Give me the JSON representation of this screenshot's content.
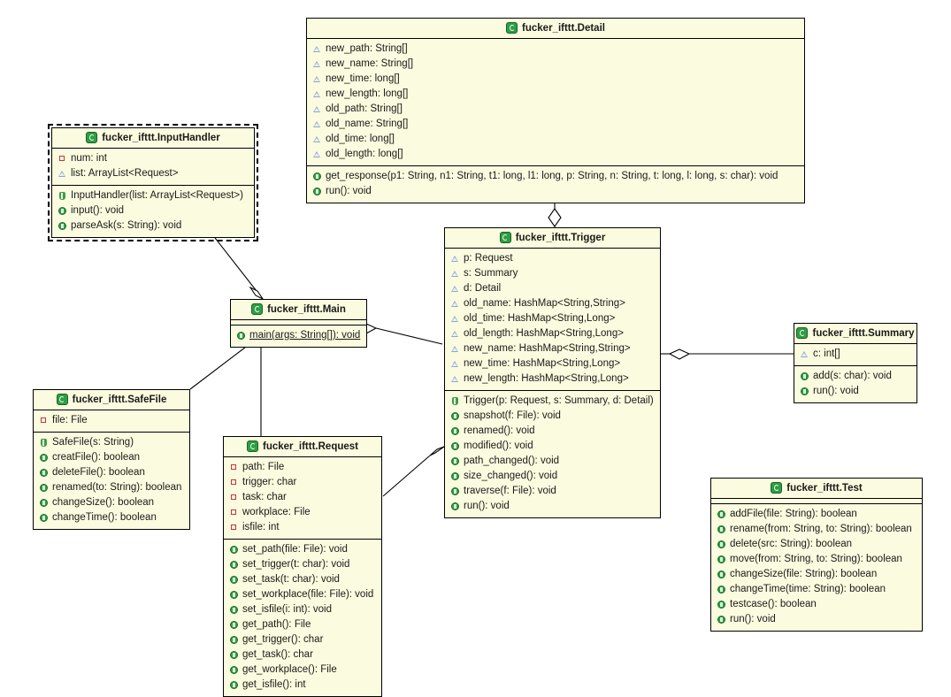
{
  "diagram": {
    "title": "fucker_ifttt UML class diagram",
    "colors": {
      "class_fill": "#fbfbdf",
      "class_border": "#000000",
      "icon_green": "#2f9e44",
      "private_red": "#c0392b",
      "package_blue": "#8fa8c8",
      "background": "#ffffff"
    }
  },
  "classes": {
    "detail": {
      "name": "fucker_ifttt.Detail",
      "attributes": [
        {
          "marker": "pkg",
          "text": "new_path: String[]"
        },
        {
          "marker": "pkg",
          "text": "new_name: String[]"
        },
        {
          "marker": "pkg",
          "text": "new_time: long[]"
        },
        {
          "marker": "pkg",
          "text": "new_length: long[]"
        },
        {
          "marker": "pkg",
          "text": "old_path: String[]"
        },
        {
          "marker": "pkg",
          "text": "old_name: String[]"
        },
        {
          "marker": "pkg",
          "text": "old_time: long[]"
        },
        {
          "marker": "pkg",
          "text": "old_length: long[]"
        }
      ],
      "methods": [
        {
          "marker": "pub",
          "text": "get_response(p1: String, n1: String, t1: long, l1: long, p: String, n: String, t: long, l: long, s: char): void"
        },
        {
          "marker": "pub",
          "text": "run(): void"
        }
      ]
    },
    "inputhandler": {
      "name": "fucker_ifttt.InputHandler",
      "selected": true,
      "attributes": [
        {
          "marker": "priv",
          "text": "num: int"
        },
        {
          "marker": "pkg",
          "text": "list: ArrayList<Request>"
        }
      ],
      "methods": [
        {
          "marker": "ctor",
          "text": "InputHandler(list: ArrayList<Request>)"
        },
        {
          "marker": "pub",
          "text": "input(): void"
        },
        {
          "marker": "pub",
          "text": "parseAsk(s: String): void"
        }
      ]
    },
    "main": {
      "name": "fucker_ifttt.Main",
      "attributes": [],
      "methods": [
        {
          "marker": "pub",
          "text": "main(args: String[]): void",
          "static": true
        }
      ]
    },
    "trigger": {
      "name": "fucker_ifttt.Trigger",
      "attributes": [
        {
          "marker": "pkg",
          "text": "p: Request"
        },
        {
          "marker": "pkg",
          "text": "s: Summary"
        },
        {
          "marker": "pkg",
          "text": "d: Detail"
        },
        {
          "marker": "pkg",
          "text": "old_name: HashMap<String,String>"
        },
        {
          "marker": "pkg",
          "text": "old_time: HashMap<String,Long>"
        },
        {
          "marker": "pkg",
          "text": "old_length: HashMap<String,Long>"
        },
        {
          "marker": "pkg",
          "text": "new_name: HashMap<String,String>"
        },
        {
          "marker": "pkg",
          "text": "new_time: HashMap<String,Long>"
        },
        {
          "marker": "pkg",
          "text": "new_length: HashMap<String,Long>"
        }
      ],
      "methods": [
        {
          "marker": "ctor",
          "text": "Trigger(p: Request, s: Summary, d: Detail)"
        },
        {
          "marker": "pub",
          "text": "snapshot(f: File): void"
        },
        {
          "marker": "pub",
          "text": "renamed(): void"
        },
        {
          "marker": "pub",
          "text": "modified(): void"
        },
        {
          "marker": "pub",
          "text": "path_changed(): void"
        },
        {
          "marker": "pub",
          "text": "size_changed(): void"
        },
        {
          "marker": "pub",
          "text": "traverse(f: File): void"
        },
        {
          "marker": "pub",
          "text": "run(): void"
        }
      ]
    },
    "summary": {
      "name": "fucker_ifttt.Summary",
      "attributes": [
        {
          "marker": "pkg",
          "text": "c: int[]"
        }
      ],
      "methods": [
        {
          "marker": "pub",
          "text": "add(s: char): void"
        },
        {
          "marker": "pub",
          "text": "run(): void"
        }
      ]
    },
    "safefile": {
      "name": "fucker_ifttt.SafeFile",
      "attributes": [
        {
          "marker": "priv",
          "text": "file: File"
        }
      ],
      "methods": [
        {
          "marker": "ctor",
          "text": "SafeFile(s: String)"
        },
        {
          "marker": "pub",
          "text": "creatFile(): boolean"
        },
        {
          "marker": "pub",
          "text": "deleteFile(): boolean"
        },
        {
          "marker": "pub",
          "text": "renamed(to: String): boolean"
        },
        {
          "marker": "pub",
          "text": "changeSize(): boolean"
        },
        {
          "marker": "pub",
          "text": "changeTime(): boolean"
        }
      ]
    },
    "request": {
      "name": "fucker_ifttt.Request",
      "attributes": [
        {
          "marker": "priv",
          "text": "path: File"
        },
        {
          "marker": "priv",
          "text": "trigger: char"
        },
        {
          "marker": "priv",
          "text": "task: char"
        },
        {
          "marker": "priv",
          "text": "workplace: File"
        },
        {
          "marker": "priv",
          "text": "isfile: int"
        }
      ],
      "methods": [
        {
          "marker": "pub",
          "text": "set_path(file: File): void"
        },
        {
          "marker": "pub",
          "text": "set_trigger(t: char): void"
        },
        {
          "marker": "pub",
          "text": "set_task(t: char): void"
        },
        {
          "marker": "pub",
          "text": "set_workplace(file: File): void"
        },
        {
          "marker": "pub",
          "text": "set_isfile(i: int): void"
        },
        {
          "marker": "pub",
          "text": "get_path(): File"
        },
        {
          "marker": "pub",
          "text": "get_trigger(): char"
        },
        {
          "marker": "pub",
          "text": "get_task(): char"
        },
        {
          "marker": "pub",
          "text": "get_workplace(): File"
        },
        {
          "marker": "pub",
          "text": "get_isfile(): int"
        }
      ]
    },
    "test": {
      "name": "fucker_ifttt.Test",
      "attributes": [],
      "methods": [
        {
          "marker": "pub",
          "text": "addFile(file: String): boolean"
        },
        {
          "marker": "pub",
          "text": "rename(from: String, to: String): boolean"
        },
        {
          "marker": "pub",
          "text": "delete(src: String): boolean"
        },
        {
          "marker": "pub",
          "text": "move(from: String, to: String): boolean"
        },
        {
          "marker": "pub",
          "text": "changeSize(file: String): boolean"
        },
        {
          "marker": "pub",
          "text": "changeTime(time: String): boolean"
        },
        {
          "marker": "pub",
          "text": "testcase(): boolean"
        },
        {
          "marker": "pub",
          "text": "run(): void"
        }
      ]
    }
  },
  "relationships": [
    {
      "from": "detail",
      "to": "trigger",
      "type": "aggregation"
    },
    {
      "from": "inputhandler",
      "to": "main",
      "type": "aggregation"
    },
    {
      "from": "main",
      "to": "trigger",
      "type": "aggregation"
    },
    {
      "from": "main",
      "to": "safefile",
      "type": "aggregation"
    },
    {
      "from": "main",
      "to": "request",
      "type": "association"
    },
    {
      "from": "request",
      "to": "trigger",
      "type": "aggregation"
    },
    {
      "from": "trigger",
      "to": "summary",
      "type": "aggregation"
    }
  ]
}
